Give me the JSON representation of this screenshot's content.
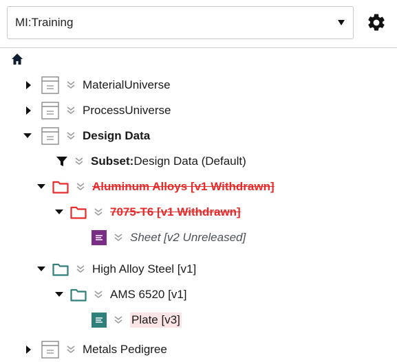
{
  "database_selector": {
    "value": "MI:Training"
  },
  "toolbar": {
    "settings_icon": "gear-icon"
  },
  "tree": {
    "home_icon": "home-icon",
    "material_universe": "MaterialUniverse",
    "process_universe": "ProcessUniverse",
    "design_data": "Design Data",
    "subset_prefix": "Subset:",
    "subset_name": "Design Data (Default)",
    "aluminum_alloys": "Aluminum Alloys [v1 Withdrawn]",
    "al_7075_t6": "7075-T6 [v1 Withdrawn]",
    "sheet": "Sheet [v2 Unreleased]",
    "high_alloy_steel": "High Alloy Steel [v1]",
    "ams_6520": "AMS 6520 [v1]",
    "plate": "Plate [v3]",
    "metals_pedigree": "Metals Pedigree"
  },
  "colors": {
    "withdrawn": "#e62b2b",
    "released_teal": "#2f7f7a",
    "unreleased_purple": "#7a2e86",
    "plate_highlight": "#fbe4e6"
  }
}
